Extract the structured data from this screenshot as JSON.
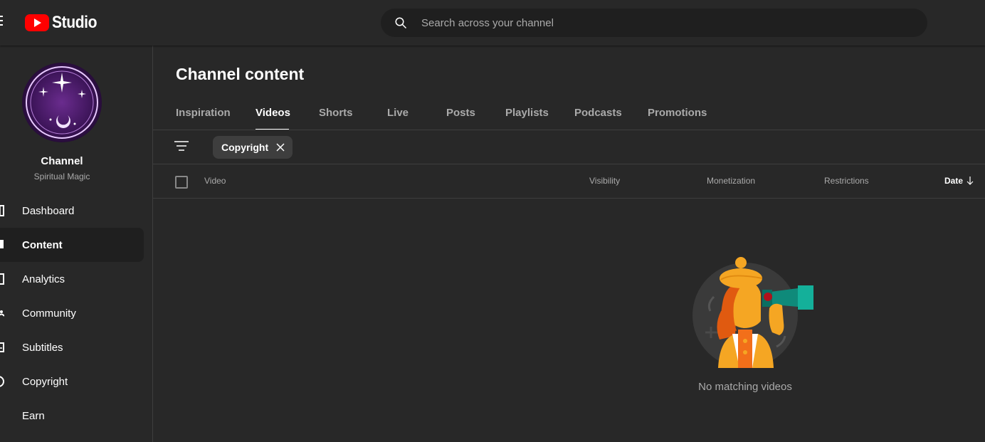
{
  "app": {
    "title": "Studio"
  },
  "search": {
    "placeholder": "Search across your channel"
  },
  "channel": {
    "title": "Channel",
    "name": "Spiritual Magic",
    "avatar_text": "Spiritual Magic"
  },
  "sidebar": {
    "items": [
      {
        "label": "Dashboard",
        "icon": "dashboard-icon",
        "active": false
      },
      {
        "label": "Content",
        "icon": "content-icon",
        "active": true
      },
      {
        "label": "Analytics",
        "icon": "analytics-icon",
        "active": false
      },
      {
        "label": "Community",
        "icon": "community-icon",
        "active": false
      },
      {
        "label": "Subtitles",
        "icon": "subtitles-icon",
        "active": false
      },
      {
        "label": "Copyright",
        "icon": "copyright-icon",
        "active": false
      },
      {
        "label": "Earn",
        "icon": "earn-icon",
        "active": false
      }
    ]
  },
  "main": {
    "title": "Channel content",
    "tabs": [
      {
        "label": "Inspiration",
        "active": false
      },
      {
        "label": "Videos",
        "active": true
      },
      {
        "label": "Shorts",
        "active": false
      },
      {
        "label": "Live",
        "active": false
      },
      {
        "label": "Posts",
        "active": false
      },
      {
        "label": "Playlists",
        "active": false
      },
      {
        "label": "Podcasts",
        "active": false
      },
      {
        "label": "Promotions",
        "active": false
      }
    ],
    "filter_chip": "Copyright",
    "columns": {
      "video": "Video",
      "visibility": "Visibility",
      "monetization": "Monetization",
      "restrictions": "Restrictions",
      "date": "Date"
    },
    "empty_message": "No matching videos"
  },
  "colors": {
    "brand": "#ff0000",
    "background": "#282828",
    "search_bg": "#1f1f1f",
    "muted": "#aaaaaa"
  }
}
